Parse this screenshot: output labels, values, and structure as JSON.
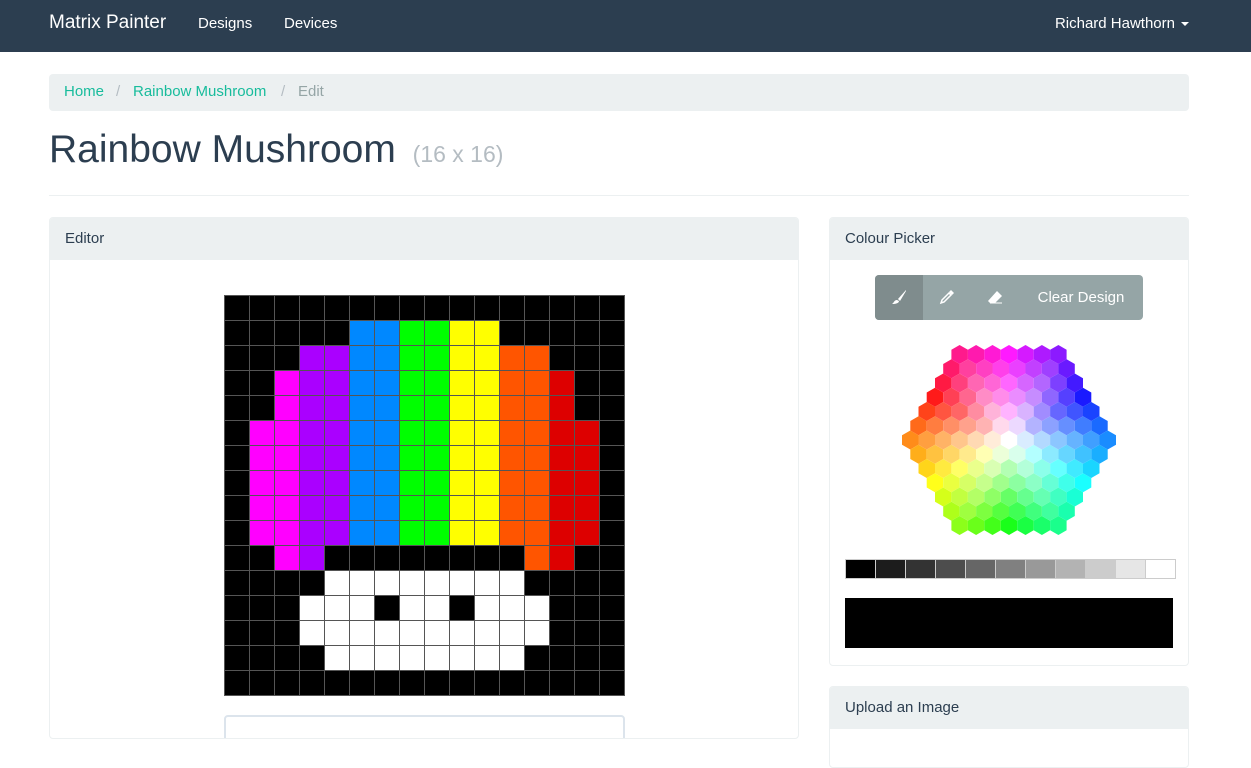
{
  "nav": {
    "brand": "Matrix Painter",
    "links": [
      "Designs",
      "Devices"
    ],
    "user": "Richard Hawthorn"
  },
  "breadcrumb": {
    "items": [
      "Home",
      "Rainbow Mushroom"
    ],
    "separator": "/",
    "active": "Edit"
  },
  "page": {
    "title": "Rainbow Mushroom",
    "size": "(16 x 16)"
  },
  "editor": {
    "heading": "Editor",
    "palette": {
      "K": "#000000",
      "W": "#ffffff",
      "M": "#ff00ff",
      "P": "#aa00ff",
      "B": "#0088ff",
      "G": "#00ff00",
      "Y": "#ffff00",
      "O": "#ff5500",
      "R": "#dd0000"
    },
    "pixels": [
      "KKKKKKKKKKKKKKKK",
      "KKKKKBBGGYYKKKKK",
      "KKKPPBBGGYYOOKKK",
      "KKMPPBBGGYYOORKK",
      "KKMPPBBGGYYOORKK",
      "KMMPPBBGGYYOORRK",
      "KMMPPBBGGYYOORRK",
      "KMMPPBBGGYYOORRK",
      "KMMPPBBGGYYOORRK",
      "KMMPPBBGGYYOORRK",
      "KKMPKKKKKKKKORKK",
      "KKKKWWWWWWWWKKKK",
      "KKKWWWKWWKWWWKKK",
      "KKKWWWWWWWWWWKKK",
      "KKKKWWWWWWWWKKKK",
      "KKKKKKKKKKKKKKKK"
    ]
  },
  "picker": {
    "heading": "Colour Picker",
    "clear_label": "Clear Design",
    "tools": [
      "paintbrush-icon",
      "eyedropper-icon",
      "eraser-icon"
    ],
    "greys": [
      "#000000",
      "#1c1c1c",
      "#333333",
      "#4d4d4d",
      "#666666",
      "#808080",
      "#999999",
      "#b3b3b3",
      "#cccccc",
      "#e6e6e6",
      "#ffffff"
    ],
    "current_colour": "#000000"
  },
  "upload": {
    "heading": "Upload an Image"
  }
}
